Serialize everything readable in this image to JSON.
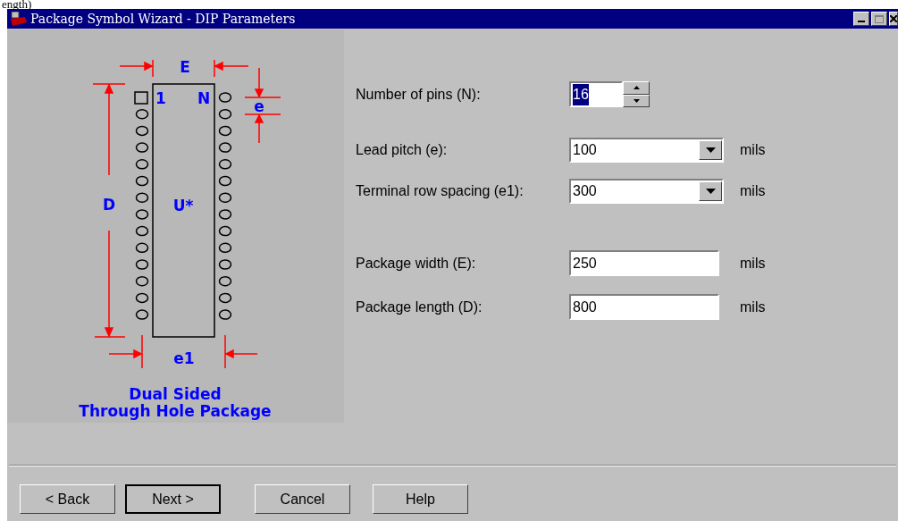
{
  "page_text": "ength)",
  "window": {
    "title": "Package Symbol Wizard - DIP Parameters"
  },
  "diagram": {
    "width_label": "E",
    "pin_first": "1",
    "pin_last": "N",
    "pitch_label": "e",
    "length_label": "D",
    "ref_label": "U*",
    "row_spacing_label": "e1",
    "caption_line_1": "Dual Sided",
    "caption_line_2": "Through Hole Package"
  },
  "fields": [
    {
      "kind": "spin",
      "label": "Number of pins (N):",
      "value": "16",
      "text_selected": true
    },
    {
      "kind": "combo",
      "label": "Lead pitch (e):",
      "value": "100",
      "unit": "mils"
    },
    {
      "kind": "combo",
      "label": "Terminal row spacing (e1):",
      "value": "300",
      "unit": "mils"
    },
    {
      "kind": "text",
      "label": "Package width (E):",
      "value": "250",
      "unit": "mils"
    },
    {
      "kind": "text",
      "label": "Package length (D):",
      "value": "800",
      "unit": "mils"
    }
  ],
  "buttons": [
    {
      "label": "< Back",
      "default": false
    },
    {
      "label": "Next >",
      "default": true
    },
    {
      "label": "Cancel",
      "default": false
    },
    {
      "label": "Help",
      "default": false
    }
  ]
}
